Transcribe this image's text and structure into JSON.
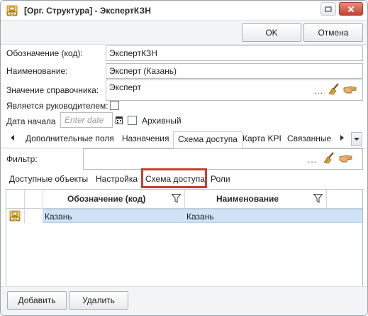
{
  "window": {
    "title": "[Орг. Структура] - ЭкспертКЗН"
  },
  "actions": {
    "ok_label": "OK",
    "cancel_label": "Отмена"
  },
  "form": {
    "code_label": "Обозначение (код):",
    "code_value": "ЭкспертКЗН",
    "name_label": "Наименование:",
    "name_value": "Эксперт (Казань)",
    "ref_label": "Значение справочника:",
    "ref_value": "Эксперт",
    "ref_dots": "...",
    "is_manager_label": "Является руководителем:",
    "is_manager_checked": false,
    "start_date_label": "Дата начала",
    "start_date_placeholder": "Enter date",
    "archived_label": "Архивный",
    "archived_checked": false
  },
  "tabs": {
    "items": [
      {
        "label": "Дополнительные поля"
      },
      {
        "label": "Назначения"
      },
      {
        "label": "Схема доступа",
        "active": true
      },
      {
        "label": "Карта KPI"
      },
      {
        "label": "Связанные"
      }
    ]
  },
  "filter": {
    "label": "Фильтр:",
    "value": "",
    "dots": "..."
  },
  "subtabs": {
    "items": [
      {
        "label": "Доступные объекты"
      },
      {
        "label": "Настройка"
      },
      {
        "label": "Схема доступа",
        "active": true
      },
      {
        "label": "Роли"
      }
    ]
  },
  "grid": {
    "columns": [
      {
        "label": "Обозначение (код)"
      },
      {
        "label": "Наименование"
      }
    ],
    "rows": [
      {
        "code": "Казань",
        "name": "Казань",
        "selected": true
      }
    ]
  },
  "footer": {
    "add_label": "Добавить",
    "delete_label": "Удалить"
  },
  "colors": {
    "selection": "#cfe3f7",
    "highlight_border": "#c7402f",
    "close_button": "#c8402e"
  },
  "icons": {
    "app": "org-structure-icon",
    "minimize": "minimize-icon",
    "close": "close-icon",
    "clear": "broom-icon",
    "select": "hand-pointer-icon",
    "calendar": "calendar-icon",
    "filter": "filter-icon",
    "row": "row-icon"
  }
}
